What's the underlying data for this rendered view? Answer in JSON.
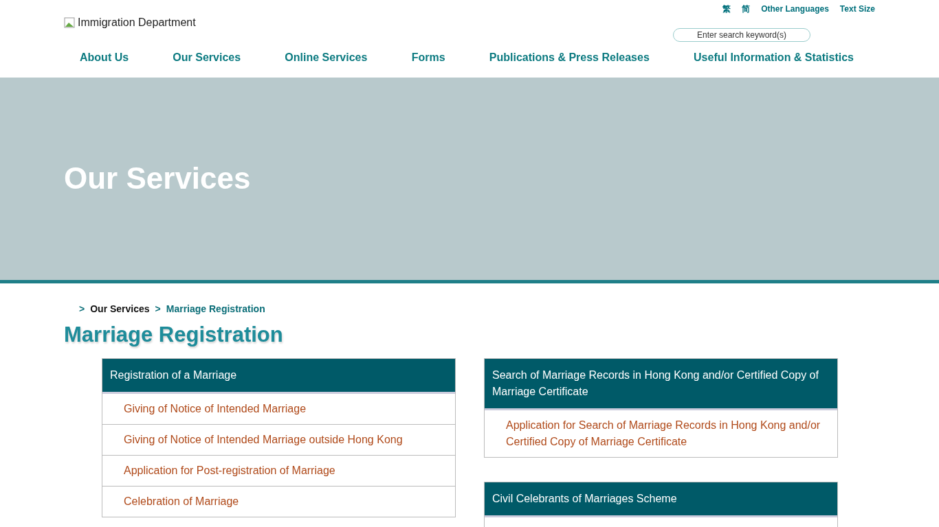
{
  "header": {
    "logo_alt": "Immigration Department",
    "top_links": [
      "繁",
      "简",
      "Other Languages",
      "Text Size"
    ],
    "search": {
      "placeholder": "Enter search keyword(s)"
    }
  },
  "nav": [
    "About Us",
    "Our Services",
    "Online Services",
    "Forms",
    "Publications & Press Releases",
    "Useful Information & Statistics"
  ],
  "banner": {
    "title": "Our Services"
  },
  "breadcrumb": [
    {
      "separator": ">",
      "label": "Our Services",
      "current": false
    },
    {
      "separator": ">",
      "label": "Marriage Registration",
      "current": true
    }
  ],
  "page_title": "Marriage Registration",
  "columns": [
    [
      {
        "title": "Registration of a Marriage",
        "links": [
          "Giving of Notice of Intended Marriage",
          "Giving of Notice of Intended Marriage outside Hong Kong",
          "Application for Post-registration of Marriage",
          "Celebration of Marriage"
        ]
      }
    ],
    [
      {
        "title": "Search of Marriage Records in Hong Kong and/or Certified Copy of Marriage Certificate",
        "links": [
          "Application for Search of Marriage Records in Hong Kong and/or Certified Copy of Marriage Certificate"
        ]
      },
      {
        "title": "Civil Celebrants of Marriages Scheme"
      }
    ]
  ]
}
